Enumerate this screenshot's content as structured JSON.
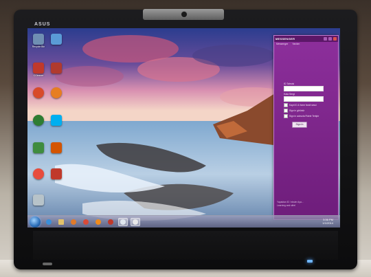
{
  "laptop": {
    "brand": "ASUS"
  },
  "desktop": {
    "icons": [
      {
        "name": "recycle-bin-icon",
        "label": "Recycle Bin",
        "color": "#6f8fb3"
      },
      {
        "name": "chrome-icon-desk",
        "label": "",
        "color": "#5a9bd6"
      },
      {
        "name": "ccleaner-icon",
        "label": "CCleaner",
        "color": "#c0392b"
      },
      {
        "name": "ccleaner2-icon",
        "label": "",
        "color": "#b03a2e"
      },
      {
        "name": "app-red-icon",
        "label": "",
        "color": "#d84b2a"
      },
      {
        "name": "firefox-icon",
        "label": "",
        "color": "#e67e22"
      },
      {
        "name": "chrome-icon",
        "label": "",
        "color": "#2e7d32"
      },
      {
        "name": "skype-icon",
        "label": "",
        "color": "#00aff0"
      },
      {
        "name": "app-green-icon",
        "label": "",
        "color": "#3f8c3f"
      },
      {
        "name": "app-mixed-icon",
        "label": "",
        "color": "#d35400"
      },
      {
        "name": "app-orange-icon",
        "label": "",
        "color": "#e74c3c"
      },
      {
        "name": "app-chrome2-icon",
        "label": "",
        "color": "#c0392b"
      },
      {
        "name": "app-folder-icon",
        "label": "",
        "color": "#b7c3c9"
      }
    ]
  },
  "messenger": {
    "title": "MESSENGER",
    "menu": [
      "Messenger",
      "Yardım"
    ],
    "id_label": "ID Tahsisi",
    "password_label": "Kala Sergi",
    "checks": [
      "Kayıt ID & fome fandi sessi",
      "Sign in görünür",
      "Sign in adınızla Fidele Tertipir"
    ],
    "signin_label": "Sign In",
    "footer_line1": "Yapaktan ID / eksier Aya...",
    "footer_line2": "Learning and sifrel"
  },
  "taskbar": {
    "items": [
      "ie",
      "explorer",
      "media",
      "chrome",
      "firefox",
      "app1",
      "app2",
      "messenger"
    ],
    "time": "3:36 PM",
    "date": "1/1/2014"
  },
  "colors": {
    "accent": "#7a2487",
    "taskbar": "#5a5a78"
  }
}
